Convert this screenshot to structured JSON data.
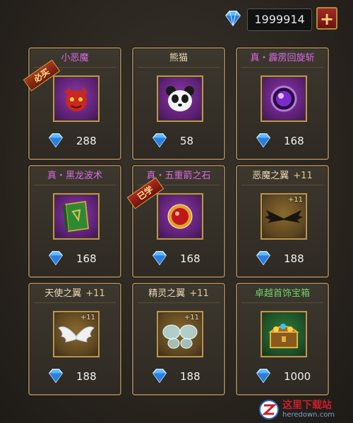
{
  "currency": {
    "icon": "diamond-icon",
    "balance": "1999914",
    "add_icon": "plus-icon",
    "add_label": "+"
  },
  "items": [
    {
      "name": "小恶魔",
      "plus": "",
      "title_color": "#d86ae6",
      "icon": "little-demon-pet-icon",
      "icon_bg": "purple",
      "ribbon": "必买",
      "price": "288"
    },
    {
      "name": "熊猫",
      "plus": "",
      "title_color": "#ecd9b8",
      "icon": "panda-pet-icon",
      "icon_bg": "purple",
      "ribbon": "",
      "price": "58"
    },
    {
      "name": "真・霹雳回旋斩",
      "plus": "",
      "title_color": "#d86ae6",
      "icon": "purple-orb-skill-icon",
      "icon_bg": "purple",
      "ribbon": "",
      "price": "168"
    },
    {
      "name": "真・黑龙波术",
      "plus": "",
      "title_color": "#d86ae6",
      "icon": "green-book-skill-icon",
      "icon_bg": "purple",
      "ribbon": "",
      "price": "168"
    },
    {
      "name": "真・五重箭之石",
      "plus": "",
      "title_color": "#d86ae6",
      "icon": "red-gold-orb-icon",
      "icon_bg": "purple",
      "ribbon": "已学",
      "price": "168"
    },
    {
      "name": "恶魔之翼",
      "plus": "+11",
      "title_color": "#ecd9b8",
      "icon": "demon-wings-icon",
      "icon_bg": "gold",
      "icon_plus": "+11",
      "ribbon": "",
      "price": "188"
    },
    {
      "name": "天使之翼",
      "plus": "+11",
      "title_color": "#ecd9b8",
      "icon": "angel-wings-icon",
      "icon_bg": "gold",
      "icon_plus": "+11",
      "ribbon": "",
      "price": "188"
    },
    {
      "name": "精灵之翼",
      "plus": "+11",
      "title_color": "#ecd9b8",
      "icon": "elf-wings-icon",
      "icon_bg": "gold",
      "icon_plus": "+11",
      "ribbon": "",
      "price": "188"
    },
    {
      "name": "卓越首饰宝箱",
      "plus": "",
      "title_color": "#6fd06a",
      "icon": "treasure-chest-icon",
      "icon_bg": "green",
      "ribbon": "",
      "price": "1000"
    }
  ],
  "watermark": {
    "icon": "site-logo-icon",
    "title": "这里下载站",
    "url": "heredown.com"
  }
}
